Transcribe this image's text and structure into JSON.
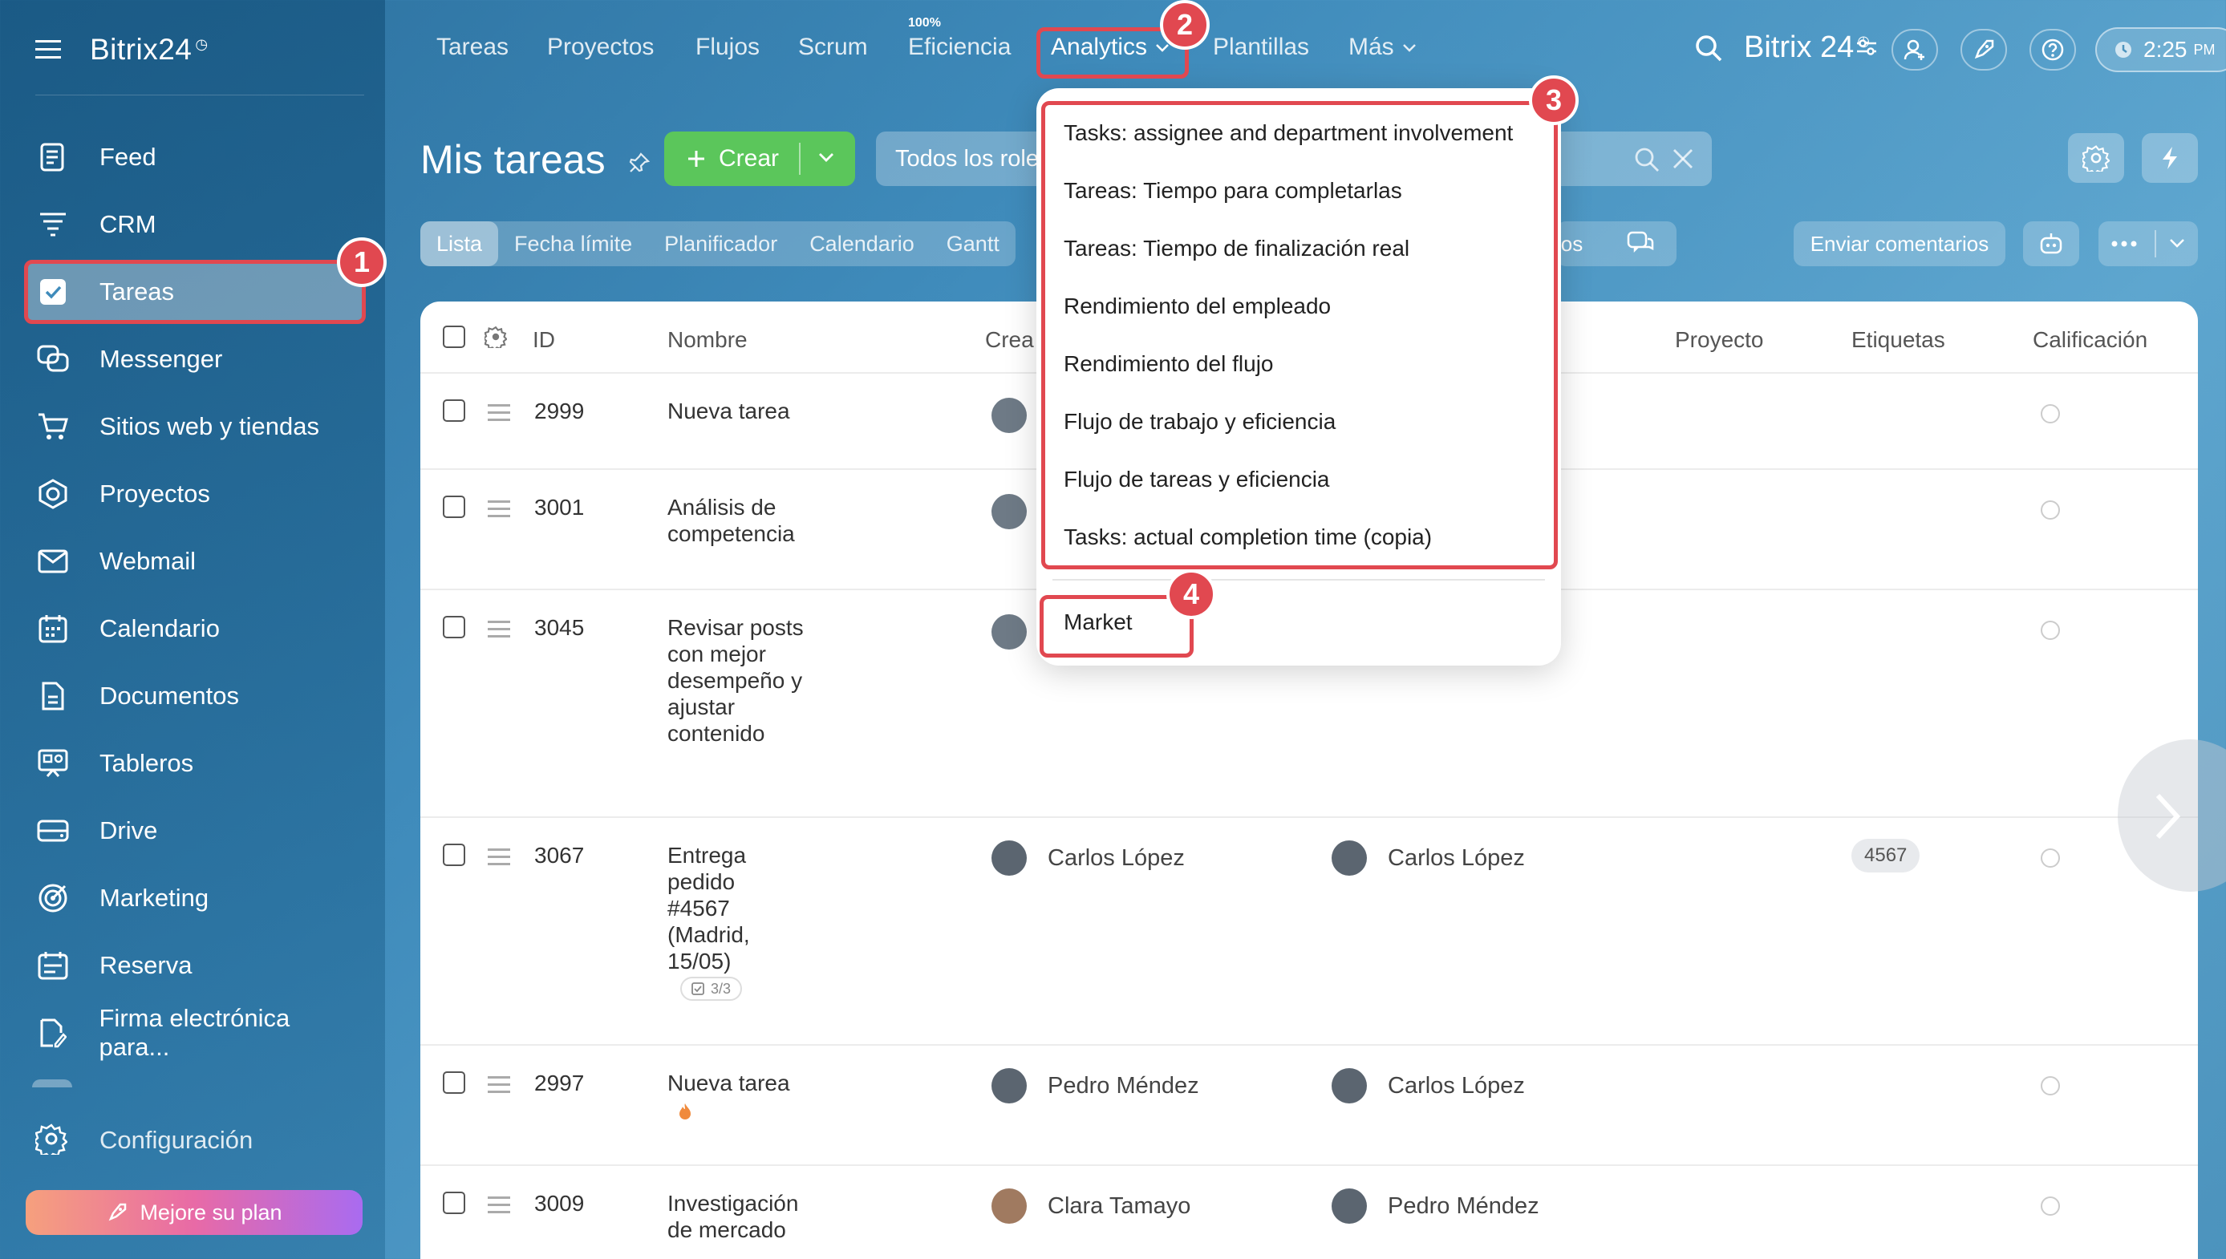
{
  "app": {
    "brand": "Bitrix24",
    "clock_mark": "◷"
  },
  "sidebar": {
    "items": [
      {
        "label": "Feed",
        "icon": "feed-icon"
      },
      {
        "label": "CRM",
        "icon": "crm-icon"
      },
      {
        "label": "Tareas",
        "icon": "tasks-check-icon",
        "active": true
      },
      {
        "label": "Messenger",
        "icon": "messenger-icon"
      },
      {
        "label": "Sitios web y tiendas",
        "icon": "cart-icon"
      },
      {
        "label": "Proyectos",
        "icon": "projects-icon"
      },
      {
        "label": "Webmail",
        "icon": "mail-icon"
      },
      {
        "label": "Calendario",
        "icon": "calendar-icon"
      },
      {
        "label": "Documentos",
        "icon": "document-icon"
      },
      {
        "label": "Tableros",
        "icon": "boards-icon"
      },
      {
        "label": "Drive",
        "icon": "drive-icon"
      },
      {
        "label": "Marketing",
        "icon": "marketing-icon"
      },
      {
        "label": "Reserva",
        "icon": "booking-icon"
      },
      {
        "label": "Firma electrónica para...",
        "icon": "e-signature-icon"
      }
    ],
    "config_label": "Configuración",
    "upgrade_label": "Mejore su plan"
  },
  "topnav": {
    "items": [
      "Tareas",
      "Proyectos",
      "Flujos",
      "Scrum",
      "Eficiencia",
      "Analytics",
      "Plantillas",
      "Más"
    ],
    "efficiency_badge": "100%",
    "brand": "Bitrix 24",
    "time": "2:25",
    "ampm": "PM"
  },
  "page": {
    "title": "Mis tareas",
    "create_label": "Crear",
    "filter_label": "Todos los role",
    "tabs": [
      "Lista",
      "Fecha límite",
      "Planificador",
      "Calendario",
      "Gantt"
    ],
    "hidden_tab_fragment": "ios",
    "feedback_label": "Enviar comentarios"
  },
  "table": {
    "headers": {
      "id": "ID",
      "name": "Nombre",
      "creator": "Crea",
      "project": "Proyecto",
      "tags": "Etiquetas",
      "rating": "Calificación"
    },
    "rows": [
      {
        "id": "2999",
        "name": "Nueva tarea",
        "creator": "",
        "responsible": "",
        "tag": "",
        "sub": ""
      },
      {
        "id": "3001",
        "name": "Análisis de competencia",
        "creator": "",
        "responsible": "",
        "tag": "",
        "sub": ""
      },
      {
        "id": "3045",
        "name": "Revisar posts con mejor desempeño y ajustar contenido",
        "creator": "",
        "responsible": "",
        "tag": "",
        "sub": ""
      },
      {
        "id": "3067",
        "name": "Entrega pedido #4567 (Madrid, 15/05)",
        "creator": "Carlos López",
        "responsible": "Carlos López",
        "tag": "4567",
        "sub": "3/3"
      },
      {
        "id": "2997",
        "name": "Nueva tarea",
        "creator": "Pedro Méndez",
        "responsible": "Carlos López",
        "tag": "",
        "sub": ""
      },
      {
        "id": "3009",
        "name": "Investigación de mercado",
        "creator": "Clara Tamayo",
        "responsible": "Pedro Méndez",
        "tag": "",
        "sub": ""
      }
    ]
  },
  "analytics_menu": {
    "items": [
      "Tasks: assignee and department involvement",
      "Tareas: Tiempo para completarlas",
      "Tareas: Tiempo de finalización real",
      "Rendimiento del empleado",
      "Rendimiento del flujo",
      "Flujo de trabajo y eficiencia",
      "Flujo de tareas y eficiencia",
      "Tasks: actual completion time (copia)"
    ],
    "market_label": "Market"
  },
  "callouts": [
    "1",
    "2",
    "3",
    "4"
  ],
  "colors": {
    "highlight": "#e14850",
    "create_button": "#5bc65b"
  }
}
